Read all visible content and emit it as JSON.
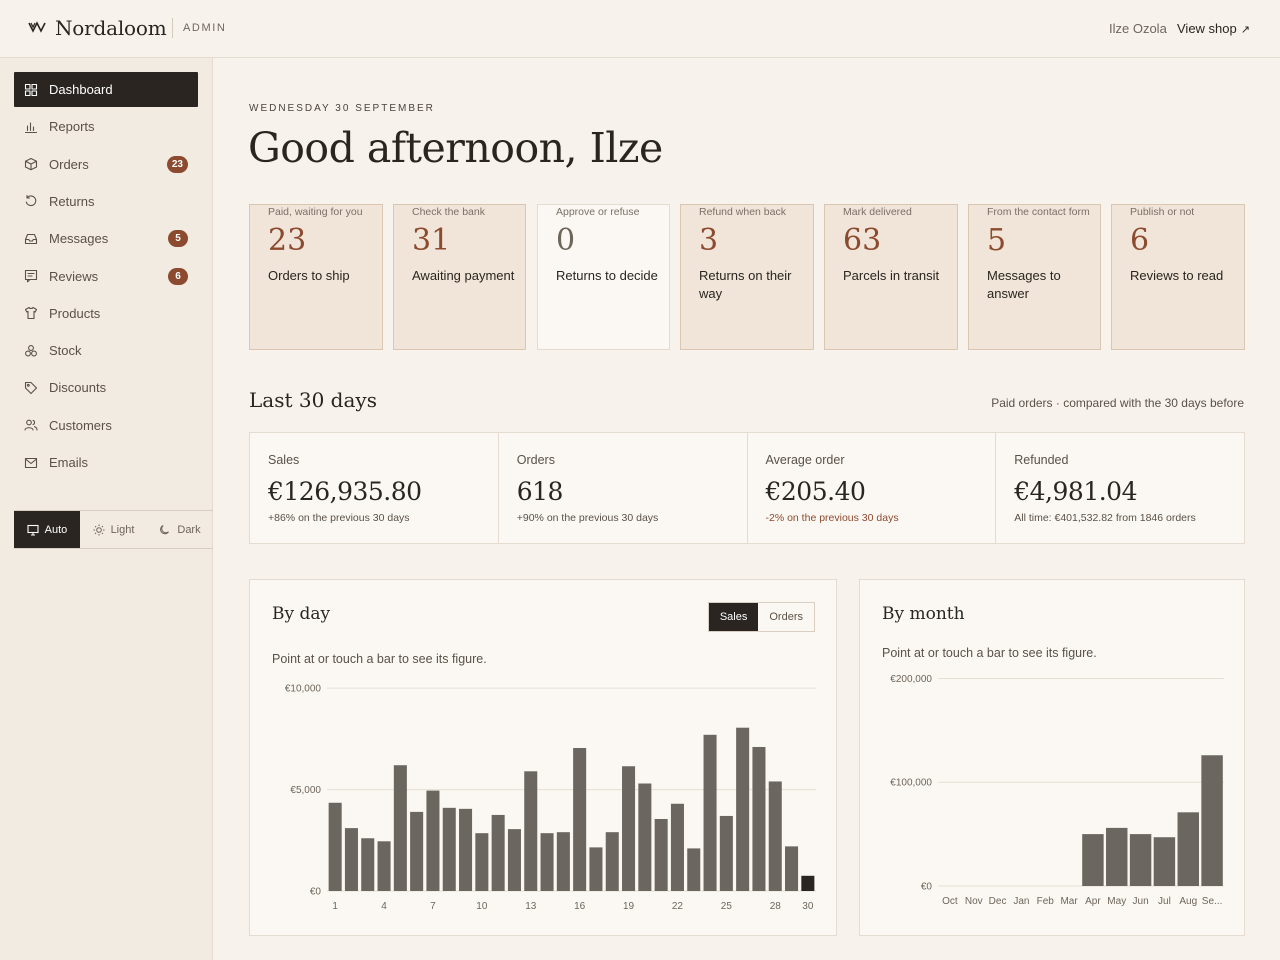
{
  "header": {
    "brand": "Nordaloom",
    "section": "ADMIN",
    "user": "Ilze Ozola",
    "view_shop": "View shop",
    "view_shop_icon": "arrow-up-right-icon"
  },
  "sidebar": {
    "items": [
      {
        "label": "Dashboard",
        "icon": "grid-icon",
        "active": true,
        "badge": ""
      },
      {
        "label": "Reports",
        "icon": "bar-chart-icon",
        "badge": ""
      },
      {
        "label": "Orders",
        "icon": "box-icon",
        "badge": "23"
      },
      {
        "label": "Returns",
        "icon": "return-icon",
        "badge": ""
      },
      {
        "label": "Messages",
        "icon": "inbox-icon",
        "badge": "5"
      },
      {
        "label": "Reviews",
        "icon": "review-icon",
        "badge": "6"
      },
      {
        "label": "Products",
        "icon": "shirt-icon",
        "badge": ""
      },
      {
        "label": "Stock",
        "icon": "boxes-icon",
        "badge": ""
      },
      {
        "label": "Discounts",
        "icon": "tag-icon",
        "badge": ""
      },
      {
        "label": "Customers",
        "icon": "users-icon",
        "badge": ""
      },
      {
        "label": "Emails",
        "icon": "mail-icon",
        "badge": ""
      }
    ],
    "theme": {
      "auto": "Auto",
      "light": "Light",
      "dark": "Dark"
    }
  },
  "main": {
    "date": "WEDNESDAY 30 SEPTEMBER",
    "greeting": "Good afternoon, Ilze",
    "tasks": [
      {
        "count": "23",
        "title": "Orders to ship",
        "sub": "Paid, waiting for you"
      },
      {
        "count": "31",
        "title": "Awaiting payment",
        "sub": "Check the bank"
      },
      {
        "count": "0",
        "title": "Returns to decide",
        "sub": "Approve or refuse"
      },
      {
        "count": "3",
        "title": "Returns on their way",
        "sub": "Refund when back"
      },
      {
        "count": "63",
        "title": "Parcels in transit",
        "sub": "Mark delivered"
      },
      {
        "count": "5",
        "title": "Messages to answer",
        "sub": "From the contact form"
      },
      {
        "count": "6",
        "title": "Reviews to read",
        "sub": "Publish or not"
      }
    ],
    "period_title": "Last 30 days",
    "period_note": "Paid orders · compared with the 30 days before",
    "kpis": [
      {
        "label": "Sales",
        "value": "€126,935.80",
        "note": "+86% on the previous 30 days"
      },
      {
        "label": "Orders",
        "value": "618",
        "note": "+90% on the previous 30 days"
      },
      {
        "label": "Average order",
        "value": "€205.40",
        "note": "-2% on the previous 30 days"
      },
      {
        "label": "Refunded",
        "value": "€4,981.04",
        "note": "All time: €401,532.82 from 1846 orders"
      }
    ],
    "by_day": {
      "title": "By day",
      "hint": "Point at or touch a bar to see its figure.",
      "toggle": {
        "sales": "Sales",
        "orders": "Orders"
      }
    },
    "by_month": {
      "title": "By month",
      "hint": "Point at or touch a bar to see its figure."
    }
  },
  "chart_data": [
    {
      "type": "bar",
      "title": "By day",
      "x": [
        1,
        2,
        3,
        4,
        5,
        6,
        7,
        8,
        9,
        10,
        11,
        12,
        13,
        14,
        15,
        16,
        17,
        18,
        19,
        20,
        21,
        22,
        23,
        24,
        25,
        26,
        27,
        28,
        29,
        30
      ],
      "x_tick_labels": [
        "1",
        "4",
        "7",
        "10",
        "13",
        "16",
        "19",
        "22",
        "25",
        "28",
        "30"
      ],
      "values": [
        4350,
        3100,
        2600,
        2450,
        6200,
        3900,
        4950,
        4100,
        4050,
        2850,
        3750,
        3050,
        5900,
        2850,
        2900,
        7050,
        2150,
        2900,
        6150,
        5300,
        3550,
        4300,
        2100,
        7700,
        3700,
        8050,
        7100,
        5400,
        2200,
        750
      ],
      "highlight_index": 29,
      "y_ticks": [
        "€0",
        "€5,000",
        "€10,000"
      ],
      "ylim": [
        0,
        10500
      ],
      "bar_color": "#6b6660",
      "highlight_color": "#2a2520",
      "grid": true
    },
    {
      "type": "bar",
      "title": "By month",
      "categories": [
        "Oct",
        "Nov",
        "Dec",
        "Jan",
        "Feb",
        "Mar",
        "Apr",
        "May",
        "Jun",
        "Jul",
        "Aug",
        "Se..."
      ],
      "values": [
        0,
        0,
        0,
        0,
        0,
        0,
        50000,
        56000,
        50000,
        47000,
        71000,
        126000
      ],
      "y_ticks": [
        "€0",
        "€100,000",
        "€200,000"
      ],
      "ylim": [
        0,
        212000
      ],
      "bar_color": "#6b6660",
      "grid": true
    }
  ],
  "colors": {
    "accent": "#8c4a2f",
    "ink": "#2a2520",
    "background": "#f7f3ec",
    "card_task": "#f0e5d8"
  }
}
